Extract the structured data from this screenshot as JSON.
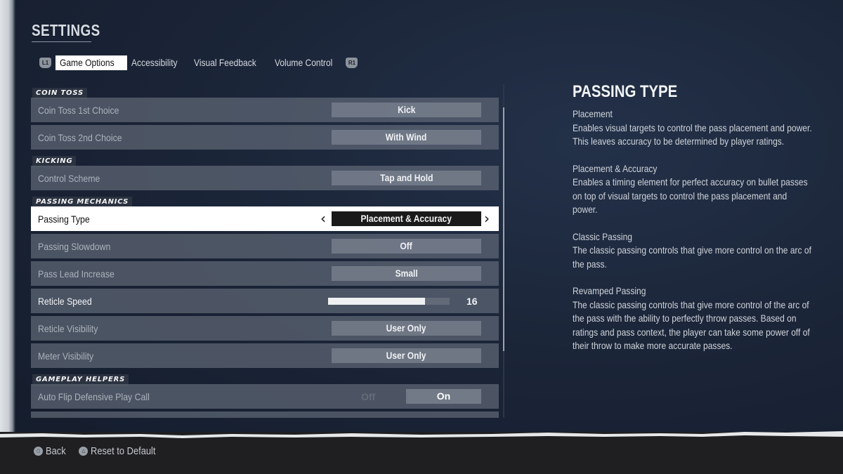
{
  "header": {
    "title": "SETTINGS",
    "left_bumper": "L1",
    "right_bumper": "R1"
  },
  "tabs": [
    {
      "label": "Game Options",
      "active": true
    },
    {
      "label": "Accessibility",
      "active": false
    },
    {
      "label": "Visual Feedback",
      "active": false
    },
    {
      "label": "Volume Control",
      "active": false
    }
  ],
  "sections": {
    "coin_toss": {
      "title": "COIN TOSS",
      "rows": [
        {
          "label": "Coin Toss 1st Choice",
          "value": "Kick"
        },
        {
          "label": "Coin Toss 2nd Choice",
          "value": "With Wind"
        }
      ]
    },
    "kicking": {
      "title": "KICKING",
      "rows": [
        {
          "label": "Control Scheme",
          "value": "Tap and Hold"
        }
      ]
    },
    "passing_mechanics": {
      "title": "PASSING MECHANICS",
      "rows": [
        {
          "label": "Passing Type",
          "value": "Placement & Accuracy",
          "selected": true
        },
        {
          "label": "Passing Slowdown",
          "value": "Off"
        },
        {
          "label": "Pass Lead Increase",
          "value": "Small"
        },
        {
          "label": "Reticle Speed",
          "value": "16",
          "slider_fraction": 0.8
        },
        {
          "label": "Reticle Visibility",
          "value": "User Only"
        },
        {
          "label": "Meter Visibility",
          "value": "User Only"
        }
      ]
    },
    "gameplay_helpers": {
      "title": "GAMEPLAY HELPERS",
      "rows": [
        {
          "label": "Auto Flip Defensive Play Call",
          "off_label": "Off",
          "value": "On"
        }
      ]
    }
  },
  "scrollbar": {
    "position_fraction": 0.07,
    "visible_fraction": 0.73
  },
  "help": {
    "title": "PASSING TYPE",
    "blocks": [
      {
        "heading": "Placement",
        "text": "Enables visual targets to control the pass placement and power. This leaves accuracy to be determined by player ratings."
      },
      {
        "heading": "Placement & Accuracy",
        "text": "Enables a timing element for perfect accuracy on bullet passes on top of visual targets to control the pass placement and power."
      },
      {
        "heading": "Classic Passing",
        "text": "The classic passing controls that give more control on the arc of the pass."
      },
      {
        "heading": "Revamped Passing",
        "text": "The classic passing controls that give more control of the arc of the pass with the ability to perfectly throw passes. Based on ratings and pass context, the player can take some power off of their throw to make more accurate passes."
      }
    ]
  },
  "footer": {
    "back": {
      "label": "Back",
      "icon": "circle-button-icon"
    },
    "reset": {
      "label": "Reset to Default",
      "icon": "triangle-button-icon"
    }
  },
  "colors": {
    "background": "#1b2538",
    "row": "#5f6876",
    "selected_row": "#ffffff",
    "footer": "#1f1f21"
  }
}
